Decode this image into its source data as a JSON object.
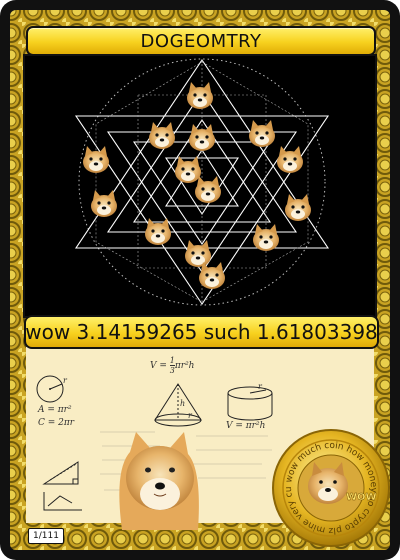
{
  "card": {
    "title": "DOGEOMTRY",
    "subtitle": "wow 3.14159265 such 1.61803398",
    "card_number": "1/111"
  },
  "formulas": {
    "cone_volume_lhs": "V = ",
    "cone_volume_num": "1",
    "cone_volume_den": "3",
    "cone_volume_rhs": "πr²h",
    "circle_area": "A = πr²",
    "circumference": "C = 2πr",
    "cylinder_volume": "V = πr²h",
    "cone_height": "h",
    "cone_radius": "r",
    "circle_radius": "r",
    "cylinder_radius": "r"
  },
  "coin": {
    "ring_text": "wow much coin how money so crypto plz mine very currency",
    "center_text": "WOW"
  },
  "colors": {
    "border": "#111111",
    "gold": "#f7d11e",
    "gold_dark": "#b8860b",
    "lower_panel": "#f9edc4",
    "art_background": "#000000",
    "star_lines": "#ffffff"
  }
}
